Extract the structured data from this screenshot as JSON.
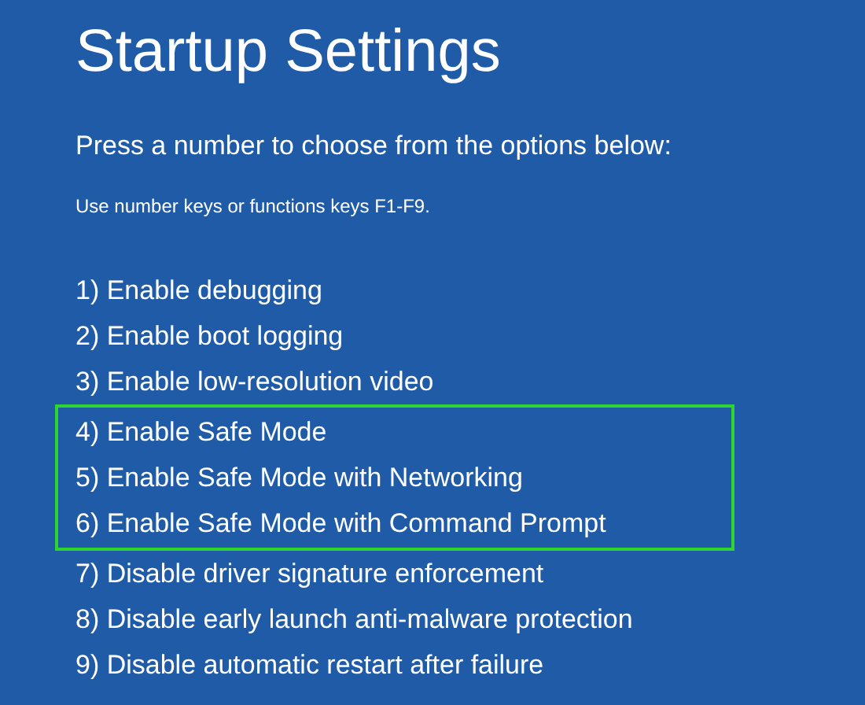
{
  "title": "Startup Settings",
  "instruction": "Press a number to choose from the options below:",
  "hint": "Use number keys or functions keys F1-F9.",
  "options": [
    {
      "label": "1) Enable debugging",
      "highlighted": false
    },
    {
      "label": "2) Enable boot logging",
      "highlighted": false
    },
    {
      "label": "3) Enable low-resolution video",
      "highlighted": false
    },
    {
      "label": "4) Enable Safe Mode",
      "highlighted": true
    },
    {
      "label": "5) Enable Safe Mode with Networking",
      "highlighted": true
    },
    {
      "label": "6) Enable Safe Mode with Command Prompt",
      "highlighted": true
    },
    {
      "label": "7) Disable driver signature enforcement",
      "highlighted": false
    },
    {
      "label": "8) Disable early launch anti-malware protection",
      "highlighted": false
    },
    {
      "label": "9) Disable automatic restart after failure",
      "highlighted": false
    }
  ]
}
